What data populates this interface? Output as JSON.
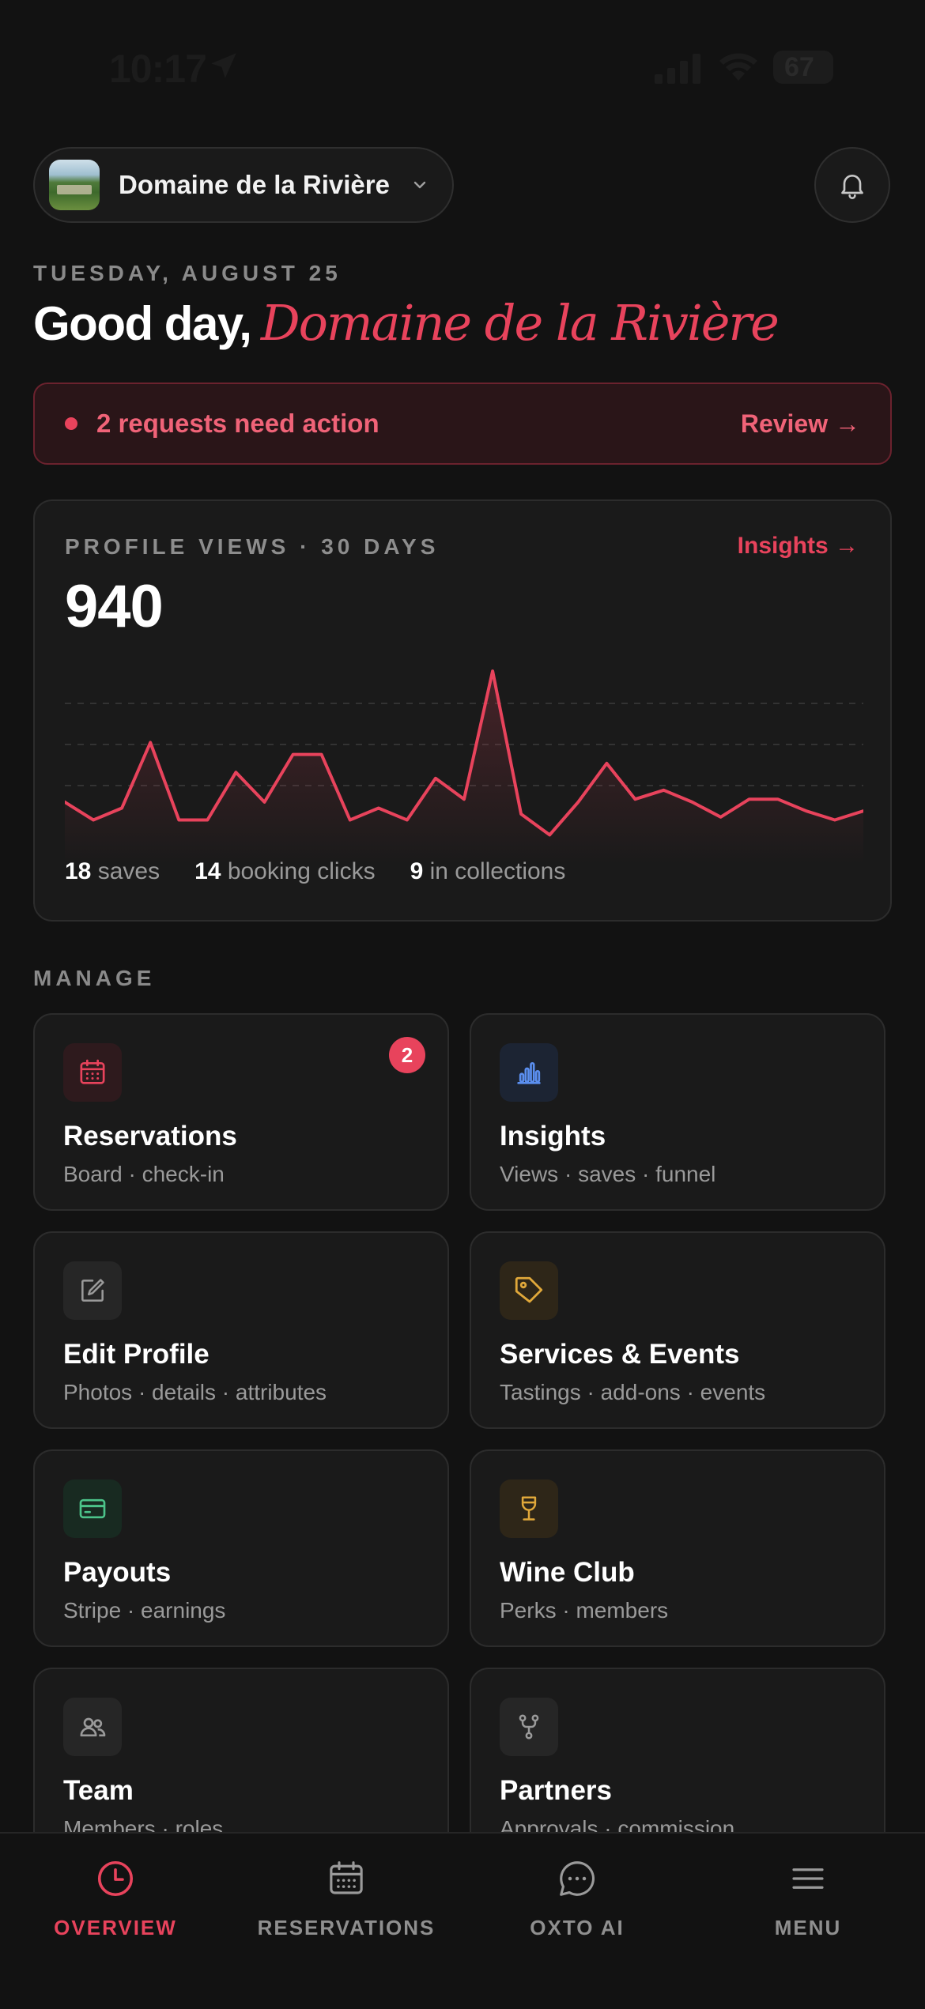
{
  "status_bar": {
    "time": "10:17",
    "battery": "67"
  },
  "header": {
    "venue_name": "Domaine de la Rivière"
  },
  "greeting": {
    "date": "TUESDAY, AUGUST 25",
    "lead": "Good day,",
    "name": "Domaine de la Rivière"
  },
  "alert": {
    "text": "2 requests need action",
    "action": "Review →"
  },
  "stats": {
    "label": "PROFILE VIEWS · 30 DAYS",
    "link": "Insights →",
    "value": "940",
    "saves_count": "18",
    "saves_label": "saves",
    "booking_count": "14",
    "booking_label": "booking clicks",
    "collections_count": "9",
    "collections_label": "in collections",
    "series": [
      32,
      26,
      30,
      52,
      26,
      26,
      42,
      32,
      48,
      48,
      26,
      30,
      26,
      40,
      33,
      76,
      28,
      21,
      32,
      45,
      33,
      36,
      32,
      27,
      33,
      33,
      29,
      26,
      29
    ]
  },
  "manage": {
    "label": "MANAGE",
    "tiles": [
      {
        "title": "Reservations",
        "sub": "Board · check-in",
        "badge": "2",
        "icon": "calendar-icon",
        "color": "#e8435c"
      },
      {
        "title": "Insights",
        "sub": "Views · saves · funnel",
        "icon": "bar-chart-icon",
        "color": "#5b8ff0"
      },
      {
        "title": "Edit Profile",
        "sub": "Photos · details · attributes",
        "icon": "edit-icon",
        "color": "#8a8a8a"
      },
      {
        "title": "Services & Events",
        "sub": "Tastings · add-ons · events",
        "icon": "tag-icon",
        "color": "#e0a83a"
      },
      {
        "title": "Payouts",
        "sub": "Stripe · earnings",
        "icon": "card-icon",
        "color": "#4cc38a"
      },
      {
        "title": "Wine Club",
        "sub": "Perks · members",
        "icon": "wine-glass-icon",
        "color": "#e0a83a"
      },
      {
        "title": "Team",
        "sub": "Members · roles",
        "icon": "users-icon",
        "color": "#8a8a8a"
      },
      {
        "title": "Partners",
        "sub": "Approvals · commission",
        "icon": "branch-icon",
        "color": "#8a8a8a"
      }
    ]
  },
  "tabs": [
    {
      "label": "OVERVIEW",
      "icon": "clock-icon",
      "active": true
    },
    {
      "label": "RESERVATIONS",
      "icon": "calendar-icon"
    },
    {
      "label": "OXTO AI",
      "icon": "chat-icon"
    },
    {
      "label": "MENU",
      "icon": "menu-icon"
    }
  ],
  "colors": {
    "accent": "#e8435c",
    "background": "#121212",
    "card": "#1a1a1a"
  }
}
